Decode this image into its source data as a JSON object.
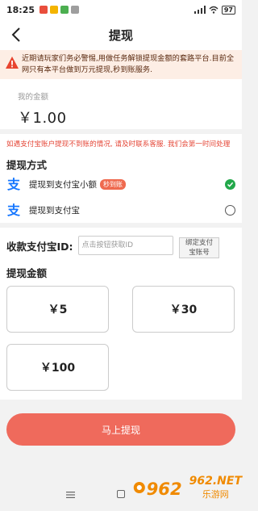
{
  "status": {
    "time": "18:25",
    "battery": "97"
  },
  "header": {
    "title": "提现"
  },
  "notice": {
    "text": "近期请玩家们务必警惕,用做任务解锁提现金额的套路平台.目前全网只有本平台做到万元提现,秒到账服务."
  },
  "balance": {
    "label": "我的金额",
    "value": "￥1.00"
  },
  "tip": {
    "text": "如遇支付宝账户提现不到账的情况, 请及时联系客服. 我们会第一时间处理"
  },
  "methods": {
    "title": "提现方式",
    "items": [
      {
        "label": "提现到支付宝小额",
        "badge": "秒到账",
        "selected": true
      },
      {
        "label": "提现到支付宝",
        "badge": "",
        "selected": false
      }
    ]
  },
  "account": {
    "label": "收款支付宝ID:",
    "placeholder": "点击按钮获取ID",
    "bind_line1": "绑定支付",
    "bind_line2": "宝账号"
  },
  "amount": {
    "title": "提现金额",
    "options": [
      "￥5",
      "￥30",
      "￥100"
    ]
  },
  "submit": {
    "label": "马上提现"
  },
  "watermark": {
    "net": "962.NET",
    "cn": "乐游网"
  },
  "colors": {
    "accent": "#ef6a5c",
    "tip": "#e5493a",
    "selected": "#22a84a",
    "alipay": "#1677ff"
  }
}
